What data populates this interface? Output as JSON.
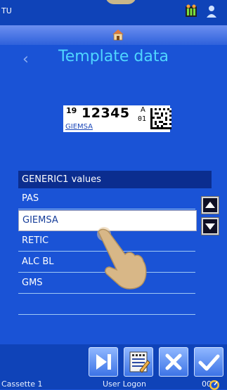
{
  "topbar": {
    "app_label": "TU"
  },
  "header": {
    "title": "Template data"
  },
  "label_preview": {
    "day": "19",
    "number": "12345",
    "letter": "A",
    "subnum": "01",
    "stain": "GIEMSA"
  },
  "list": {
    "header": "GENERIC1 values",
    "items": [
      {
        "label": "PAS"
      },
      {
        "label": "GIEMSA"
      },
      {
        "label": "RETIC"
      },
      {
        "label": "ALC BL"
      },
      {
        "label": "GMS"
      },
      {
        "label": ""
      }
    ],
    "selected_index": 1
  },
  "statusbar": {
    "left": "Cassette 1",
    "center": "User Logon",
    "right": "00"
  },
  "colors": {
    "background": "#1a53d6",
    "title": "#4fd6ff",
    "list_header": "#0b2d8f",
    "selected_text": "#173e9a"
  },
  "icons": [
    "back-arrow-icon",
    "home-icon",
    "battery-icon",
    "user-icon",
    "scroll-up-icon",
    "scroll-down-icon",
    "skip-icon",
    "print-template-icon",
    "cancel-icon",
    "confirm-icon",
    "gauge-icon",
    "finger-pointer-icon"
  ]
}
